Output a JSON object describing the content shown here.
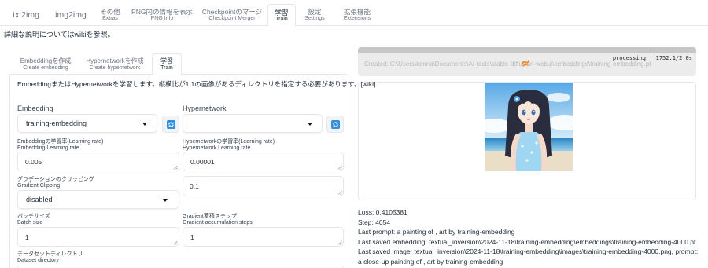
{
  "top_tabs": [
    {
      "label": "txt2img"
    },
    {
      "label": "img2img"
    },
    {
      "label": "その他",
      "sub": "Extras"
    },
    {
      "label": "PNG内の情報を表示",
      "sub": "PNG Info"
    },
    {
      "label": "Checkpointのマージ",
      "sub": "Checkpoint Merger"
    },
    {
      "label": "学習",
      "sub": "Train",
      "selected": true
    },
    {
      "label": "設定",
      "sub": "Settings"
    },
    {
      "label": "拡張機能",
      "sub": "Extensions"
    }
  ],
  "notice": "詳細な説明についてはwikiを参照。",
  "train_tabs": [
    {
      "label": "Embeddingを作成",
      "sub": "Create embedding"
    },
    {
      "label": "Hypernetworkを作成",
      "sub": "Create hypernetwork"
    },
    {
      "label": "学習",
      "sub": "Train",
      "selected": true
    }
  ],
  "train_panel": {
    "description": "EmbeddingまたはHypernetworkを学習します。縦横比が1:1の画像があるディレクトリを指定する必要があります。",
    "wiki_link": "[wiki]",
    "embedding": {
      "label": "Embedding",
      "value": "training-embedding"
    },
    "hypernetwork": {
      "label": "Hypernetwork",
      "value": ""
    },
    "embedding_lr": {
      "label": "Embeddingの学習率(Learning rate)",
      "sub": "Embedding Learning rate",
      "value": "0.005"
    },
    "hypernetwork_lr": {
      "label": "Hypernetworkの学習率(Learning rate)",
      "sub": "Hypernetwork Learning rate",
      "value": "0.00001"
    },
    "gradient_clipping": {
      "label": "グラデーションのクリッピング",
      "sub": "Gradient Clipping",
      "value": "disabled",
      "clip_value": "0.1"
    },
    "batch_size": {
      "label": "バッチサイズ",
      "sub": "Batch size",
      "value": "1"
    },
    "grad_accum": {
      "label": "Gradient蓄積ステップ",
      "sub": "Gradient accumulation steps",
      "value": "1"
    },
    "dataset_dir": {
      "label": "データセットディレクトリ",
      "sub": "Dataset directory",
      "value": ""
    }
  },
  "output": {
    "progress_status": "processing | 1752.1/2.0s",
    "created_text": "Created: C:\\Users\\kimna\\Documents\\AI-tools\\stable-diffusion-webui\\embeddings\\training-embedding.pt",
    "loss": "Loss: 0.4105381",
    "step": "Step: 4054",
    "last_prompt": "Last prompt: a painting of , art by training-embedding",
    "last_saved_embedding": "Last saved embedding: textual_inversion\\2024-11-18\\training-embedding\\embeddings\\training-embedding-4000.pt",
    "last_saved_image": "Last saved image: textual_inversion\\2024-11-18\\training-embedding\\images\\training-embedding-4000.png, prompt: a close-up painting of , art by training-embedding"
  },
  "icons": {
    "refresh": "refresh-icon",
    "dropdown": "chevron-down-icon",
    "loading": "loading-icon",
    "resize": "resize-handle-icon"
  },
  "colors": {
    "accent": "#2f8ee0",
    "loading": "#f08a24",
    "border": "#e5e7eb",
    "text": "#1f2937",
    "muted": "#6b7280"
  }
}
